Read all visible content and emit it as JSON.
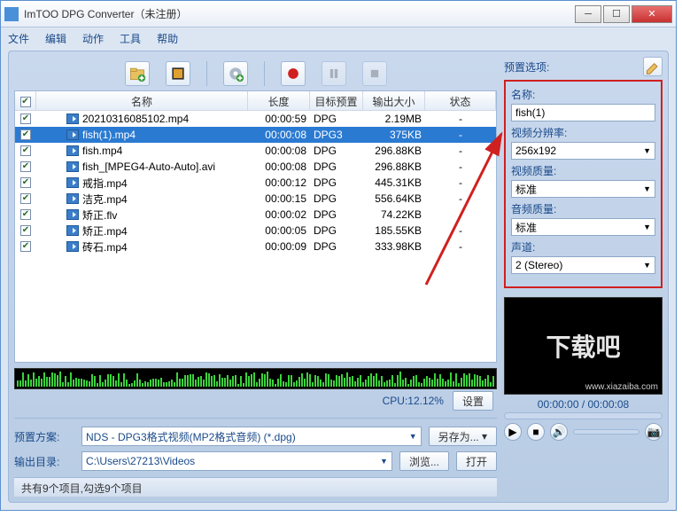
{
  "window": {
    "title": "ImTOO DPG Converter（未注册）"
  },
  "menu": [
    "文件",
    "编辑",
    "动作",
    "工具",
    "帮助"
  ],
  "columns": {
    "name": "名称",
    "length": "长度",
    "preset": "目标预置",
    "size": "输出大小",
    "status": "状态"
  },
  "files": [
    {
      "name": "20210316085102.mp4",
      "len": "00:00:59",
      "preset": "DPG",
      "size": "2.19MB",
      "status": "-",
      "sel": false
    },
    {
      "name": "fish(1).mp4",
      "len": "00:00:08",
      "preset": "DPG3",
      "size": "375KB",
      "status": "-",
      "sel": true
    },
    {
      "name": "fish.mp4",
      "len": "00:00:08",
      "preset": "DPG",
      "size": "296.88KB",
      "status": "-",
      "sel": false
    },
    {
      "name": "fish_[MPEG4-Auto-Auto].avi",
      "len": "00:00:08",
      "preset": "DPG",
      "size": "296.88KB",
      "status": "-",
      "sel": false
    },
    {
      "name": "戒指.mp4",
      "len": "00:00:12",
      "preset": "DPG",
      "size": "445.31KB",
      "status": "-",
      "sel": false
    },
    {
      "name": "洁克.mp4",
      "len": "00:00:15",
      "preset": "DPG",
      "size": "556.64KB",
      "status": "-",
      "sel": false
    },
    {
      "name": "矫正.flv",
      "len": "00:00:02",
      "preset": "DPG",
      "size": "74.22KB",
      "status": "-",
      "sel": false
    },
    {
      "name": "矫正.mp4",
      "len": "00:00:05",
      "preset": "DPG",
      "size": "185.55KB",
      "status": "-",
      "sel": false
    },
    {
      "name": "砖石.mp4",
      "len": "00:00:09",
      "preset": "DPG",
      "size": "333.98KB",
      "status": "-",
      "sel": false
    }
  ],
  "cpu": {
    "label": "CPU:12.12%",
    "settings": "设置"
  },
  "profile": {
    "label": "预置方案:",
    "value": "NDS - DPG3格式视频(MP2格式音频) (*.dpg)",
    "saveAs": "另存为..."
  },
  "output": {
    "label": "输出目录:",
    "value": "C:\\Users\\27213\\Videos",
    "browse": "浏览...",
    "open": "打开"
  },
  "status": "共有9个项目,勾选9个项目",
  "rightHeader": {
    "title": "预置选项:"
  },
  "preset": {
    "name": {
      "label": "名称:",
      "value": "fish(1)"
    },
    "resolution": {
      "label": "视频分辨率:",
      "value": "256x192"
    },
    "vq": {
      "label": "视频质量:",
      "value": "标准"
    },
    "aq": {
      "label": "音频质量:",
      "value": "标准"
    },
    "channel": {
      "label": "声道:",
      "value": "2 (Stereo)"
    }
  },
  "preview": {
    "time": "00:00:00 / 00:00:08",
    "watermark": "下载吧",
    "sub": "www.xiazaiba.com"
  }
}
